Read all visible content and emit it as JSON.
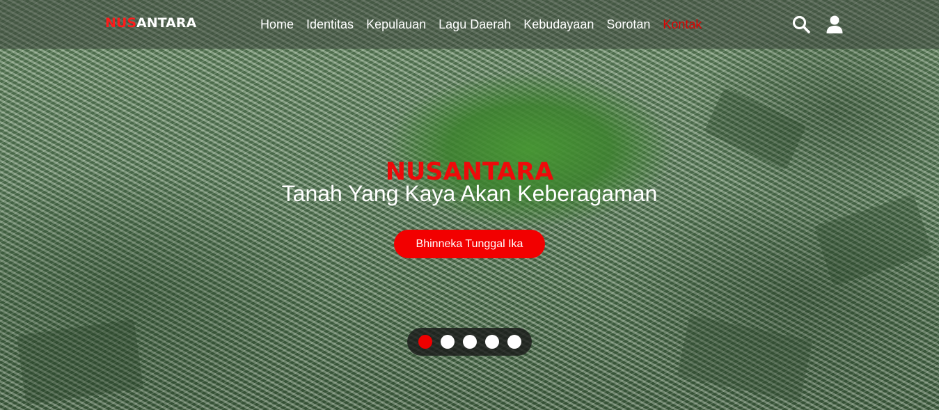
{
  "brand": {
    "logo_part1": "NUS",
    "logo_part2": "ANTARA",
    "accent_color": "#ee0000"
  },
  "nav": {
    "items": [
      {
        "label": "Home",
        "active": false
      },
      {
        "label": "Identitas",
        "active": false
      },
      {
        "label": "Kepulauan",
        "active": false
      },
      {
        "label": "Lagu Daerah",
        "active": false
      },
      {
        "label": "Kebudayaan",
        "active": false
      },
      {
        "label": "Sorotan",
        "active": false
      },
      {
        "label": "Kontak",
        "active": true
      }
    ],
    "icons": [
      "search-icon",
      "user-icon"
    ]
  },
  "hero": {
    "title": "NUSANTARA",
    "subtitle": "Tanah Yang Kaya Akan Keberagaman",
    "button_label": "Bhinneka Tunggal Ika"
  },
  "carousel": {
    "slide_count": 5,
    "active_slide": 1
  }
}
